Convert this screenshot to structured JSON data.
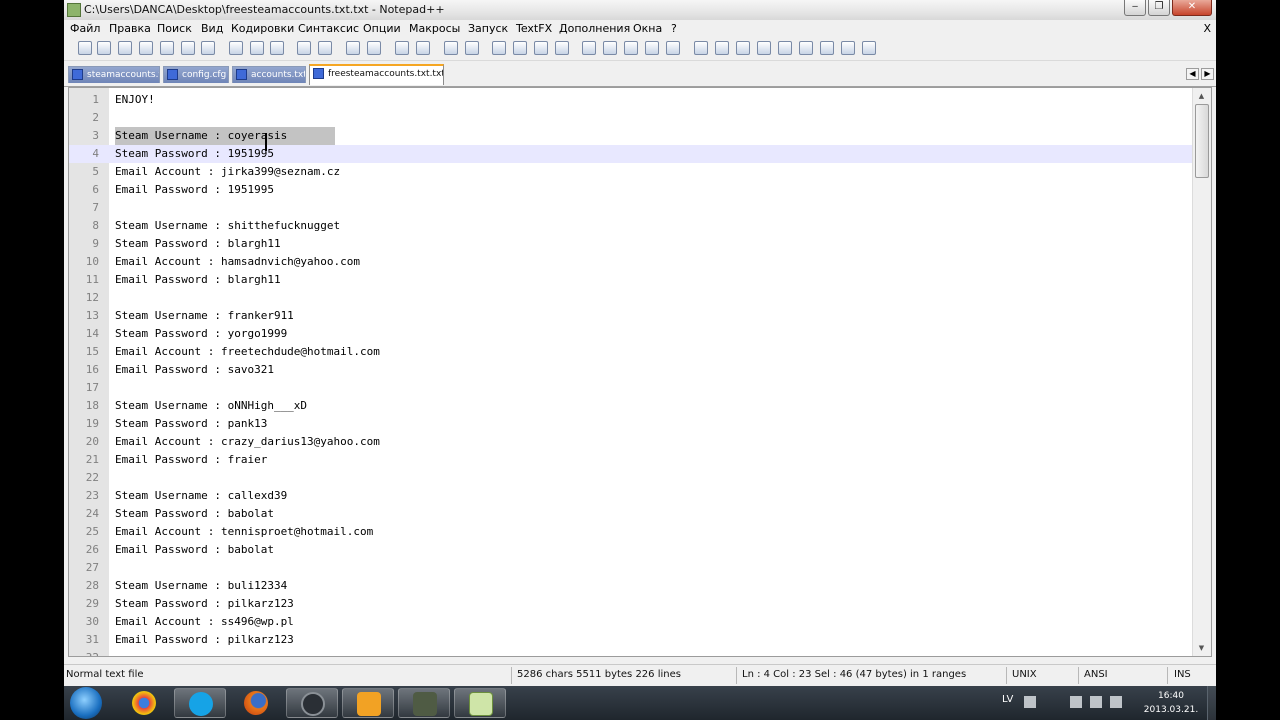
{
  "window": {
    "title": "C:\\Users\\DANCA\\Desktop\\freesteamaccounts.txt.txt - Notepad++",
    "minimize_label": "‒",
    "maximize_label": "❐",
    "close_label": "✕"
  },
  "menu": {
    "items": [
      "Файл",
      "Правка",
      "Поиск",
      "Вид",
      "Кодировки",
      "Синтаксис",
      "Опции",
      "Макросы",
      "Запуск",
      "TextFX",
      "Дополнения",
      "Окна",
      "?"
    ],
    "close_label": "X"
  },
  "toolbar": {
    "icons": [
      "new-file-icon",
      "open-file-icon",
      "save-icon",
      "save-all-icon",
      "close-file-icon",
      "close-all-icon",
      "print-icon",
      "cut-icon",
      "copy-icon",
      "paste-icon",
      "undo-icon",
      "redo-icon",
      "find-icon",
      "replace-icon",
      "zoom-in-icon",
      "zoom-out-icon",
      "sync-vertical-icon",
      "sync-horizontal-icon",
      "word-wrap-icon",
      "show-all-chars-icon",
      "indent-guide-icon",
      "user-lang-icon",
      "record-macro-icon",
      "stop-macro-icon",
      "play-macro-icon",
      "run-macro-multiple-icon",
      "save-macro-icon",
      "fold-up-icon",
      "arrow-up-icon",
      "arrow-down-icon",
      "collapse-icon",
      "folder-icon",
      "window-icon",
      "window-alt-icon",
      "bookmark-icon",
      "spellcheck-icon"
    ]
  },
  "tabs": [
    {
      "label": "steamaccounts.txt",
      "active": false
    },
    {
      "label": "config.cfg",
      "active": false
    },
    {
      "label": "accounts.txt",
      "active": false
    },
    {
      "label": "freesteamaccounts.txt.txt",
      "active": true
    }
  ],
  "editor": {
    "current_line": 4,
    "lines": [
      {
        "n": "1",
        "text": "ENJOY!"
      },
      {
        "n": "2",
        "text": ""
      },
      {
        "n": "3",
        "text": "Steam Username : coyerasis"
      },
      {
        "n": "4",
        "text": "Steam Password : 1951995"
      },
      {
        "n": "5",
        "text": "Email Account : jirka399@seznam.cz"
      },
      {
        "n": "6",
        "text": "Email Password : 1951995"
      },
      {
        "n": "7",
        "text": ""
      },
      {
        "n": "8",
        "text": "Steam Username : shitthefucknugget"
      },
      {
        "n": "9",
        "text": "Steam Password : blargh11"
      },
      {
        "n": "10",
        "text": "Email Account : hamsadnvich@yahoo.com"
      },
      {
        "n": "11",
        "text": "Email Password : blargh11"
      },
      {
        "n": "12",
        "text": ""
      },
      {
        "n": "13",
        "text": "Steam Username : franker911"
      },
      {
        "n": "14",
        "text": "Steam Password : yorgo1999"
      },
      {
        "n": "15",
        "text": "Email Account : freetechdude@hotmail.com"
      },
      {
        "n": "16",
        "text": "Email Password : savo321"
      },
      {
        "n": "17",
        "text": ""
      },
      {
        "n": "18",
        "text": "Steam Username : oNNHigh___xD"
      },
      {
        "n": "19",
        "text": "Steam Password : pank13"
      },
      {
        "n": "20",
        "text": "Email Account : crazy_darius13@yahoo.com"
      },
      {
        "n": "21",
        "text": "Email Password : fraier"
      },
      {
        "n": "22",
        "text": ""
      },
      {
        "n": "23",
        "text": "Steam Username : callexd39"
      },
      {
        "n": "24",
        "text": "Steam Password : babolat"
      },
      {
        "n": "25",
        "text": "Email Account : tennisproet@hotmail.com"
      },
      {
        "n": "26",
        "text": "Email Password : babolat"
      },
      {
        "n": "27",
        "text": ""
      },
      {
        "n": "28",
        "text": "Steam Username : buli12334"
      },
      {
        "n": "29",
        "text": "Steam Password : pilkarz123"
      },
      {
        "n": "30",
        "text": "Email Account : ss496@wp.pl"
      },
      {
        "n": "31",
        "text": "Email Password : pilkarz123"
      },
      {
        "n": "32",
        "text": ""
      }
    ]
  },
  "status": {
    "file_type": "Normal text file",
    "size": "5286 chars   5511 bytes   226 lines",
    "position": "Ln : 4    Col : 23    Sel : 46 (47 bytes) in 1 ranges",
    "eol": "UNIX",
    "encoding": "ANSI",
    "mode": "INS"
  },
  "taskbar": {
    "apps": [
      "chrome-icon",
      "skype-icon",
      "firefox-icon",
      "steam-icon",
      "media-player-icon",
      "game-icon",
      "notepadpp-icon"
    ],
    "language": "LV",
    "time": "16:40",
    "date": "2013.03.21."
  }
}
